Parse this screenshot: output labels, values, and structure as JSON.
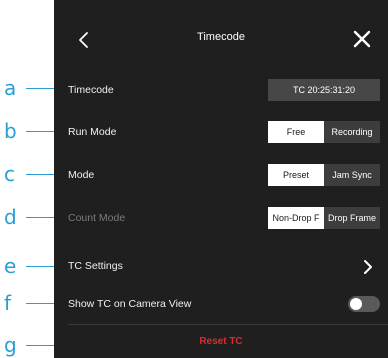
{
  "callouts": [
    "a",
    "b",
    "c",
    "d",
    "e",
    "f",
    "g"
  ],
  "header": {
    "title": "Timecode",
    "back_icon": "chevron-left-icon",
    "close_icon": "close-icon"
  },
  "rows": {
    "timecode": {
      "label": "Timecode",
      "value": "TC 20:25:31:20"
    },
    "run_mode": {
      "label": "Run Mode",
      "options": [
        "Free",
        "Recording"
      ],
      "selected": "Free"
    },
    "mode": {
      "label": "Mode",
      "options": [
        "Preset",
        "Jam Sync"
      ],
      "selected": "Preset"
    },
    "count_mode": {
      "label": "Count Mode",
      "options": [
        "Non-Drop F",
        "Drop Frame"
      ],
      "selected": "Non-Drop F",
      "disabled": true
    },
    "tc_settings": {
      "label": "TC Settings",
      "icon": "chevron-right-icon"
    },
    "show_tc": {
      "label": "Show TC on Camera View",
      "toggle_on": false
    }
  },
  "reset": {
    "label": "Reset TC"
  },
  "colors": {
    "accent_callout": "#2a9fd6",
    "danger": "#e02a2a",
    "panel_bg": "#1f1f1f"
  }
}
